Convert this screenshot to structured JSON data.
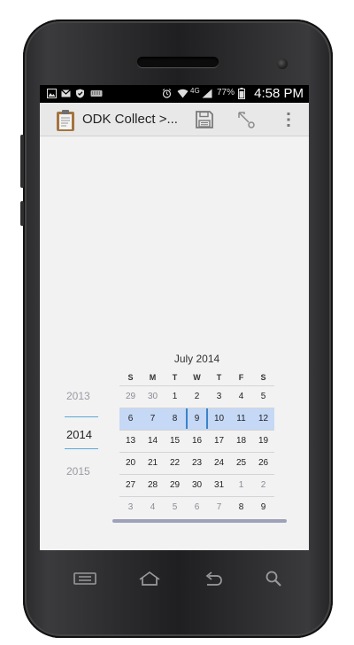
{
  "status_bar": {
    "battery": "77%",
    "network": "4G",
    "time": "4:58 PM",
    "left_icons": [
      "gallery-icon",
      "gmail-icon",
      "shield-icon",
      "keyboard-icon"
    ],
    "right_icons": [
      "alarm-icon",
      "wifi-icon",
      "signal-icon",
      "battery-icon"
    ]
  },
  "action_bar": {
    "title": "ODK Collect >...",
    "actions": [
      "save-icon",
      "navigate-icon",
      "overflow-menu-icon"
    ]
  },
  "date_picker": {
    "years": [
      "2013",
      "2014",
      "2015"
    ],
    "selected_year": "2014",
    "month_title": "July 2014",
    "weekdays": [
      "S",
      "M",
      "T",
      "W",
      "T",
      "F",
      "S"
    ],
    "weeks": [
      [
        "29",
        "30",
        "1",
        "2",
        "3",
        "4",
        "5"
      ],
      [
        "6",
        "7",
        "8",
        "9",
        "10",
        "11",
        "12"
      ],
      [
        "13",
        "14",
        "15",
        "16",
        "17",
        "18",
        "19"
      ],
      [
        "20",
        "21",
        "22",
        "23",
        "24",
        "25",
        "26"
      ],
      [
        "27",
        "28",
        "29",
        "30",
        "31",
        "1",
        "2"
      ],
      [
        "3",
        "4",
        "5",
        "6",
        "7",
        "8",
        "9"
      ]
    ],
    "selected_day": "9",
    "colors": {
      "selected_week": "#c5d8f5",
      "selected_marker": "#3a83c7",
      "year_underline": "#5aa8d6"
    }
  },
  "nav_bar": {
    "buttons": [
      "menu-icon",
      "home-icon",
      "back-icon",
      "search-icon"
    ]
  }
}
